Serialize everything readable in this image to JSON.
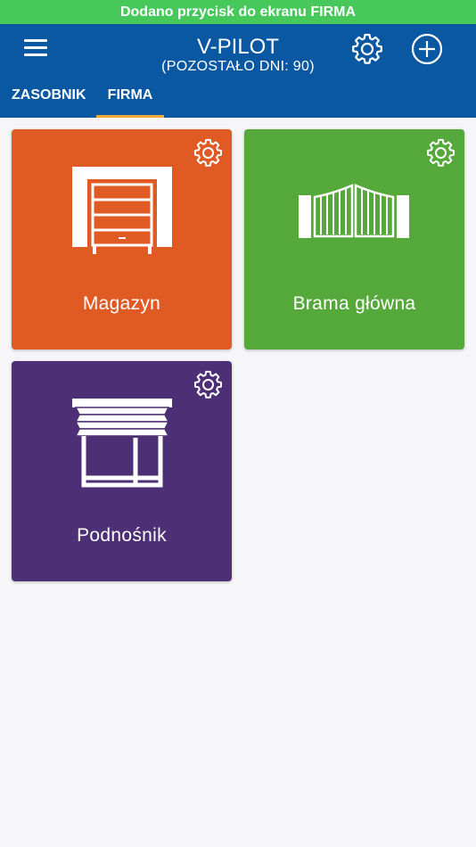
{
  "toast": {
    "text": "Dodano przycisk do ekranu FIRMA",
    "color": "#46c85a"
  },
  "header": {
    "title": "V-PILOT",
    "subtitle": "(POZOSTAŁO DNI: 90)",
    "background": "#0b58a2",
    "icons": [
      "menu-icon",
      "gear-icon",
      "plus-circle-icon"
    ]
  },
  "tabs": [
    {
      "label": "ZASOBNIK",
      "active": false
    },
    {
      "label": "FIRMA",
      "active": true
    }
  ],
  "tiles": [
    {
      "label": "Magazyn",
      "color": "#e05a23",
      "icon": "garage-door-icon"
    },
    {
      "label": "Brama główna",
      "color": "#55a93b",
      "icon": "gate-icon"
    },
    {
      "label": "Podnośnik",
      "color": "#4c2f74",
      "icon": "blind-window-icon"
    }
  ],
  "accent": "#f2a83a"
}
